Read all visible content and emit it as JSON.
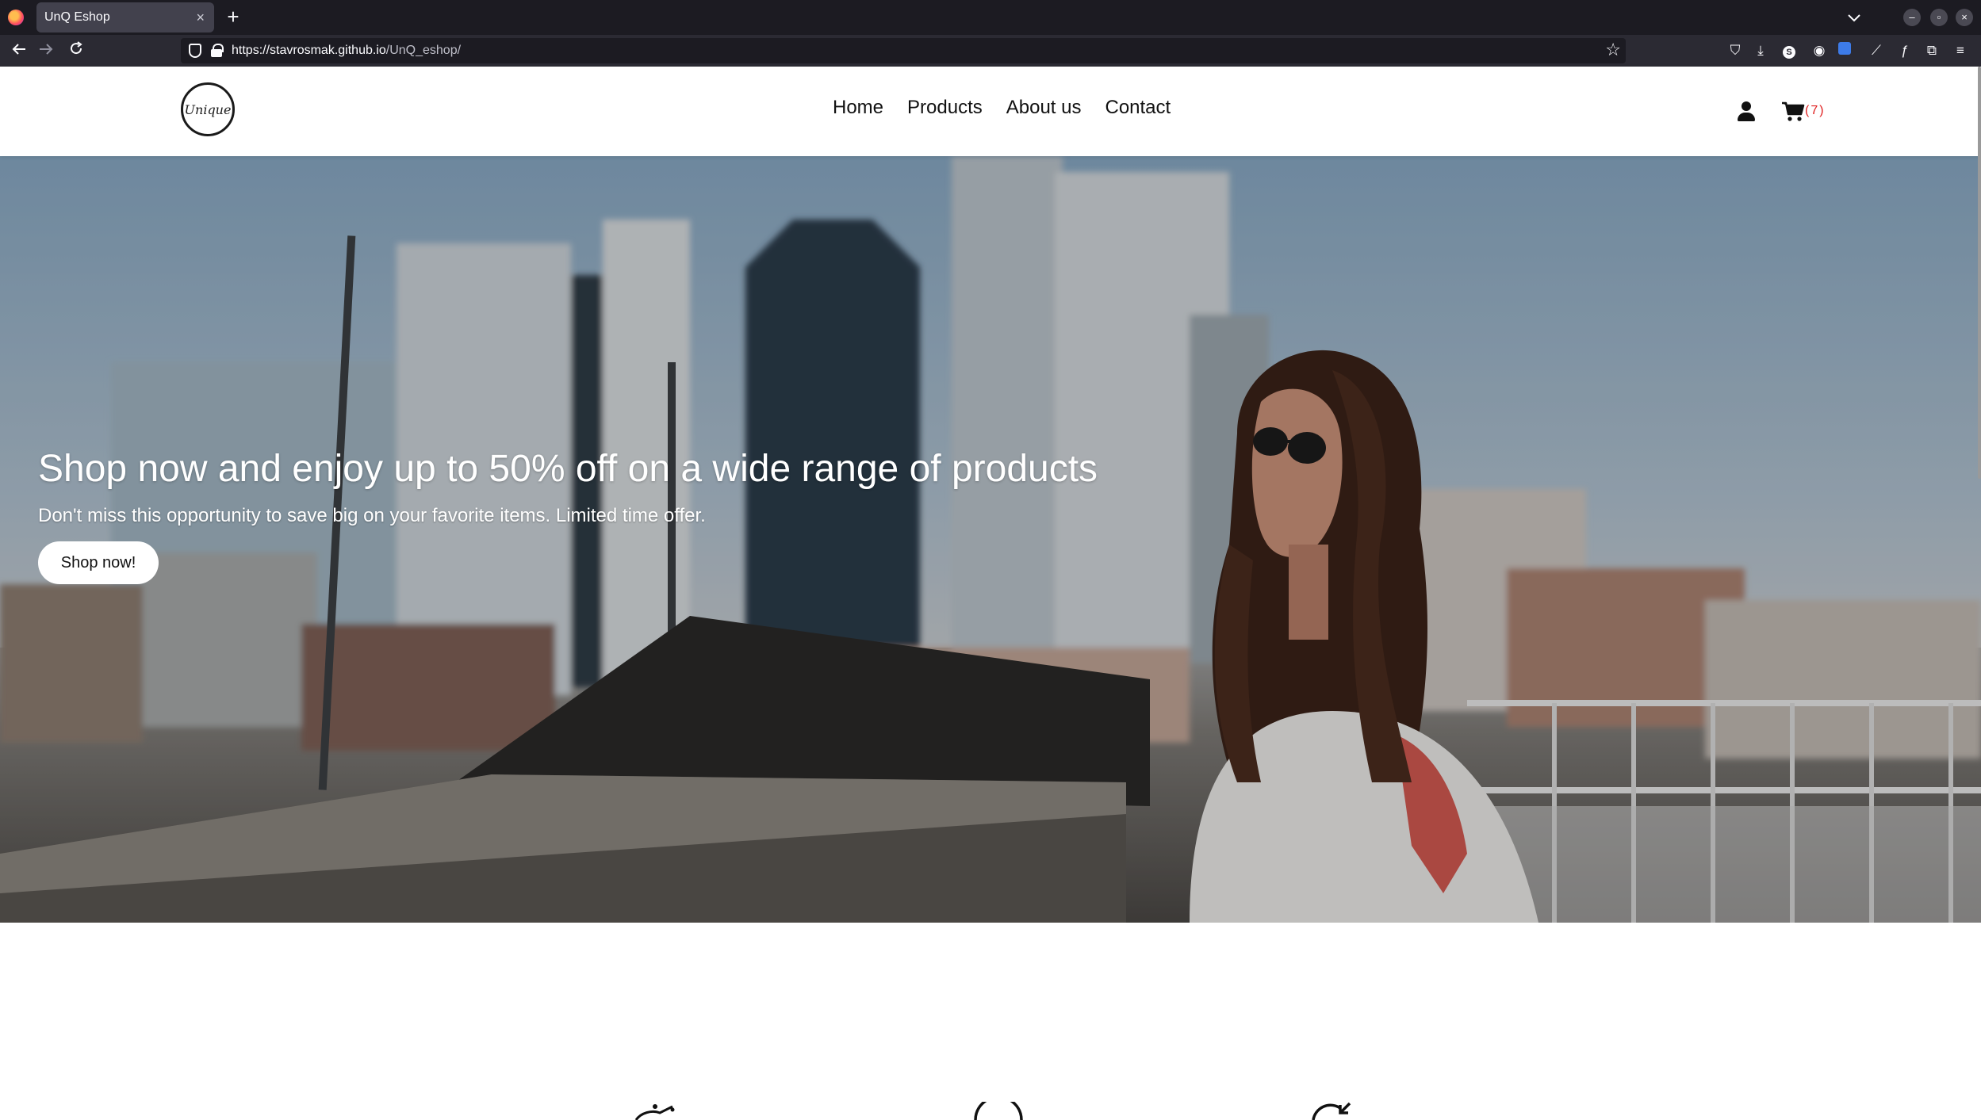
{
  "browser": {
    "tab_title": "UnQ Eshop",
    "tab_close": "×",
    "new_tab": "+",
    "url_host": "https://stavrosmak.github.io",
    "url_path": "/UnQ_eshop/"
  },
  "site": {
    "logo_text": "Unique",
    "nav": [
      "Home",
      "Products",
      "About us",
      "Contact"
    ],
    "cart_count": "(7)",
    "accent_color": "#e02020"
  },
  "hero": {
    "title": "Shop now and enjoy up to 50% off on a wide range of products",
    "subtitle": "Don't miss this opportunity to save big on your favorite items. Limited time offer.",
    "cta_label": "Shop now!"
  },
  "icons": {
    "back": "arrow-left-icon",
    "forward": "arrow-right-icon",
    "reload": "reload-icon",
    "user": "user-icon",
    "cart": "cart-icon"
  }
}
